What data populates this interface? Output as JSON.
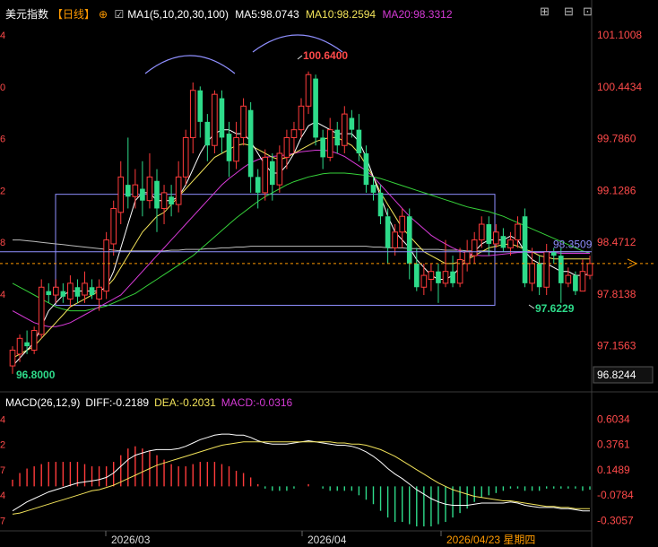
{
  "header": {
    "symbol": "美元指数",
    "period": "【日线】",
    "ma_label": "MA1(5,10,20,30,100)",
    "ma5": "MA5:98.0743",
    "ma10": "MA10:98.2594",
    "ma20": "MA20:98.3312"
  },
  "macd_header": {
    "label": "MACD(26,12,9)",
    "diff": "DIFF:-0.2189",
    "dea": "DEA:-0.2031",
    "macd": "MACD:-0.0316"
  },
  "colors": {
    "up": "#ff3b3b",
    "down": "#2edb8a",
    "ma5": "#ffffff",
    "ma10": "#f2e35a",
    "ma20": "#d63ad6",
    "ma30": "#36d13a",
    "ma100": "#bbbbbb",
    "box": "#8f8fff",
    "last_price": "#ff9a00",
    "cursor_line": "#8f8fff"
  },
  "chart_data": [
    {
      "type": "candlestick",
      "title": "美元指数 【日线】",
      "price_axis": [
        "101.1008",
        "100.4434",
        "99.7860",
        "99.1286",
        "98.4712",
        "97.8138",
        "97.1563"
      ],
      "left_axis_ticks": [
        "4",
        "0",
        "6",
        "2",
        "8",
        "4"
      ],
      "current_label": "96.8244",
      "cursor_label": "98.3509",
      "ylim": [
        96.65,
        101.32
      ],
      "annotations": {
        "high": "100.6400",
        "low_start": "96.8000",
        "low_recent": "97.6229"
      },
      "x_labels": [
        "2026/03",
        "2026/04",
        "2026/04/23 星期四"
      ],
      "candles": [
        [
          96.9,
          97.1,
          96.8,
          97.15
        ],
        [
          97.05,
          97.25,
          96.95,
          97.3
        ],
        [
          97.2,
          97.15,
          97.05,
          97.35
        ],
        [
          97.1,
          97.35,
          97.05,
          97.4
        ],
        [
          97.3,
          97.9,
          97.25,
          98.0
        ],
        [
          97.85,
          97.8,
          97.7,
          97.95
        ],
        [
          97.8,
          97.9,
          97.7,
          98.0
        ],
        [
          97.85,
          97.78,
          97.7,
          97.95
        ],
        [
          97.75,
          97.95,
          97.65,
          98.05
        ],
        [
          97.9,
          97.78,
          97.7,
          98.0
        ],
        [
          97.8,
          97.95,
          97.7,
          98.1
        ],
        [
          97.9,
          97.8,
          97.75,
          98.0
        ],
        [
          97.75,
          97.9,
          97.6,
          98.0
        ],
        [
          97.85,
          98.5,
          97.75,
          98.6
        ],
        [
          98.45,
          98.9,
          98.3,
          99.0
        ],
        [
          98.85,
          99.3,
          98.7,
          99.5
        ],
        [
          99.2,
          99.05,
          98.9,
          99.8
        ],
        [
          99.05,
          99.2,
          98.9,
          99.4
        ],
        [
          99.15,
          99.0,
          98.8,
          99.5
        ],
        [
          99.0,
          99.3,
          98.9,
          99.6
        ],
        [
          99.25,
          98.9,
          98.6,
          99.4
        ],
        [
          98.9,
          99.1,
          98.7,
          99.2
        ],
        [
          99.05,
          98.95,
          98.8,
          99.2
        ],
        [
          98.95,
          99.3,
          98.85,
          99.5
        ],
        [
          99.3,
          99.8,
          99.2,
          99.9
        ],
        [
          99.8,
          100.4,
          99.6,
          100.5
        ],
        [
          100.4,
          100.0,
          99.8,
          100.45
        ],
        [
          100.0,
          99.7,
          99.5,
          100.1
        ],
        [
          99.7,
          100.35,
          99.6,
          100.4
        ],
        [
          100.3,
          99.8,
          99.6,
          100.4
        ],
        [
          99.85,
          99.5,
          99.3,
          100.0
        ],
        [
          99.5,
          99.8,
          99.4,
          100.0
        ],
        [
          99.8,
          100.2,
          99.7,
          100.3
        ],
        [
          100.15,
          99.3,
          99.1,
          100.25
        ],
        [
          99.3,
          99.1,
          98.9,
          99.4
        ],
        [
          99.1,
          99.55,
          99.0,
          99.65
        ],
        [
          99.5,
          99.2,
          99.0,
          99.6
        ],
        [
          99.2,
          99.6,
          99.1,
          99.7
        ],
        [
          99.55,
          99.8,
          99.4,
          99.9
        ],
        [
          99.8,
          99.9,
          99.6,
          100.0
        ],
        [
          99.9,
          100.2,
          99.8,
          100.3
        ],
        [
          100.2,
          100.6,
          100.1,
          100.64
        ],
        [
          100.55,
          99.8,
          99.7,
          100.6
        ],
        [
          99.8,
          99.55,
          99.4,
          99.9
        ],
        [
          99.55,
          99.9,
          99.5,
          100.05
        ],
        [
          99.9,
          99.7,
          99.6,
          100.0
        ],
        [
          99.7,
          100.1,
          99.6,
          100.2
        ],
        [
          100.05,
          99.9,
          99.8,
          100.15
        ],
        [
          99.9,
          99.6,
          99.5,
          100.1
        ],
        [
          99.6,
          99.2,
          99.1,
          99.7
        ],
        [
          99.2,
          99.1,
          99.0,
          99.3
        ],
        [
          99.1,
          98.8,
          98.7,
          99.2
        ],
        [
          98.8,
          98.4,
          98.2,
          98.9
        ],
        [
          98.4,
          98.6,
          98.3,
          98.7
        ],
        [
          98.6,
          98.8,
          98.4,
          98.9
        ],
        [
          98.8,
          98.2,
          98.0,
          98.9
        ],
        [
          98.2,
          97.9,
          97.85,
          98.4
        ],
        [
          97.9,
          98.05,
          97.8,
          98.2
        ],
        [
          98.0,
          98.1,
          97.85,
          98.2
        ],
        [
          98.1,
          97.95,
          97.7,
          98.2
        ],
        [
          97.95,
          98.1,
          97.9,
          98.5
        ],
        [
          98.1,
          97.95,
          97.9,
          98.3
        ],
        [
          97.95,
          98.25,
          97.9,
          98.4
        ],
        [
          98.2,
          98.35,
          98.1,
          98.5
        ],
        [
          98.3,
          98.5,
          98.2,
          98.6
        ],
        [
          98.5,
          98.7,
          98.4,
          98.8
        ],
        [
          98.7,
          98.45,
          98.3,
          98.8
        ],
        [
          98.45,
          98.6,
          98.4,
          98.7
        ],
        [
          98.55,
          98.4,
          98.35,
          98.65
        ],
        [
          98.4,
          98.5,
          98.3,
          98.6
        ],
        [
          98.5,
          98.7,
          98.4,
          98.8
        ],
        [
          98.8,
          97.95,
          97.9,
          98.9
        ],
        [
          97.95,
          98.2,
          97.85,
          98.4
        ],
        [
          98.2,
          97.9,
          97.8,
          98.3
        ],
        [
          97.9,
          98.35,
          97.8,
          98.45
        ],
        [
          98.35,
          98.3,
          98.2,
          98.4
        ],
        [
          98.3,
          97.95,
          97.7,
          98.4
        ],
        [
          97.95,
          98.05,
          97.9,
          98.15
        ],
        [
          98.05,
          97.85,
          97.8,
          98.1
        ],
        [
          97.85,
          98.1,
          97.85,
          98.25
        ],
        [
          98.05,
          98.2,
          98.0,
          98.3
        ]
      ],
      "ma5": [
        96.9,
        97.0,
        97.1,
        97.2,
        97.4,
        97.6,
        97.7,
        97.8,
        97.85,
        97.85,
        97.85,
        97.85,
        97.85,
        97.9,
        98.1,
        98.4,
        98.7,
        99.0,
        99.1,
        99.1,
        99.0,
        99.0,
        99.0,
        99.05,
        99.2,
        99.4,
        99.6,
        99.75,
        99.85,
        99.9,
        99.9,
        99.85,
        99.85,
        99.75,
        99.6,
        99.45,
        99.35,
        99.35,
        99.45,
        99.6,
        99.8,
        99.95,
        100.0,
        99.95,
        99.9,
        99.85,
        99.85,
        99.85,
        99.75,
        99.55,
        99.3,
        99.05,
        98.8,
        98.6,
        98.5,
        98.4,
        98.25,
        98.15,
        98.05,
        98.0,
        98.0,
        98.05,
        98.15,
        98.25,
        98.35,
        98.45,
        98.5,
        98.5,
        98.5,
        98.55,
        98.5,
        98.35,
        98.25,
        98.2,
        98.2,
        98.15,
        98.1,
        98.1,
        98.05,
        98.05,
        98.07
      ],
      "ma10": [
        97.0,
        97.05,
        97.1,
        97.15,
        97.25,
        97.35,
        97.45,
        97.55,
        97.65,
        97.7,
        97.75,
        97.8,
        97.85,
        97.9,
        98.0,
        98.15,
        98.3,
        98.45,
        98.6,
        98.7,
        98.8,
        98.85,
        98.95,
        99.05,
        99.15,
        99.25,
        99.35,
        99.45,
        99.55,
        99.6,
        99.65,
        99.7,
        99.72,
        99.7,
        99.65,
        99.6,
        99.55,
        99.52,
        99.55,
        99.6,
        99.65,
        99.7,
        99.75,
        99.78,
        99.8,
        99.8,
        99.75,
        99.7,
        99.6,
        99.45,
        99.3,
        99.1,
        98.95,
        98.8,
        98.65,
        98.55,
        98.45,
        98.35,
        98.3,
        98.25,
        98.2,
        98.2,
        98.22,
        98.25,
        98.3,
        98.35,
        98.4,
        98.42,
        98.44,
        98.45,
        98.42,
        98.38,
        98.35,
        98.3,
        98.28,
        98.26,
        98.26,
        98.26,
        98.26,
        98.26,
        98.26
      ],
      "ma20": [
        97.6,
        97.55,
        97.5,
        97.45,
        97.42,
        97.4,
        97.4,
        97.42,
        97.45,
        97.5,
        97.55,
        97.6,
        97.65,
        97.7,
        97.75,
        97.8,
        97.9,
        98.0,
        98.1,
        98.2,
        98.3,
        98.4,
        98.5,
        98.6,
        98.7,
        98.8,
        98.9,
        99.0,
        99.1,
        99.2,
        99.28,
        99.35,
        99.42,
        99.48,
        99.52,
        99.55,
        99.56,
        99.57,
        99.58,
        99.6,
        99.62,
        99.63,
        99.64,
        99.64,
        99.63,
        99.6,
        99.56,
        99.5,
        99.44,
        99.38,
        99.3,
        99.2,
        99.1,
        99.0,
        98.9,
        98.8,
        98.72,
        98.64,
        98.56,
        98.5,
        98.45,
        98.4,
        98.36,
        98.33,
        98.31,
        98.3,
        98.3,
        98.31,
        98.32,
        98.33,
        98.34,
        98.34,
        98.34,
        98.34,
        98.34,
        98.34,
        98.33,
        98.33,
        98.33,
        98.33,
        98.33
      ],
      "ma30": [
        97.95,
        97.9,
        97.85,
        97.8,
        97.75,
        97.7,
        97.65,
        97.62,
        97.6,
        97.6,
        97.6,
        97.62,
        97.64,
        97.66,
        97.7,
        97.74,
        97.78,
        97.82,
        97.88,
        97.94,
        98.0,
        98.06,
        98.12,
        98.18,
        98.24,
        98.3,
        98.38,
        98.46,
        98.54,
        98.62,
        98.7,
        98.78,
        98.85,
        98.92,
        98.99,
        99.05,
        99.1,
        99.15,
        99.2,
        99.24,
        99.27,
        99.3,
        99.32,
        99.34,
        99.35,
        99.35,
        99.35,
        99.34,
        99.33,
        99.32,
        99.3,
        99.28,
        99.25,
        99.22,
        99.19,
        99.16,
        99.13,
        99.1,
        99.07,
        99.04,
        99.01,
        98.98,
        98.95,
        98.92,
        98.9,
        98.88,
        98.86,
        98.83,
        98.8,
        98.76,
        98.72,
        98.68,
        98.64,
        98.6,
        98.56,
        98.52,
        98.48,
        98.44,
        98.4,
        98.36,
        98.33
      ],
      "ma100": [
        98.5,
        98.5,
        98.49,
        98.48,
        98.47,
        98.46,
        98.45,
        98.44,
        98.43,
        98.42,
        98.41,
        98.4,
        98.39,
        98.38,
        98.37,
        98.36,
        98.36,
        98.36,
        98.36,
        98.36,
        98.36,
        98.36,
        98.37,
        98.37,
        98.38,
        98.38,
        98.38,
        98.39,
        98.39,
        98.4,
        98.4,
        98.41,
        98.41,
        98.42,
        98.42,
        98.42,
        98.42,
        98.42,
        98.42,
        98.42,
        98.42,
        98.42,
        98.42,
        98.42,
        98.42,
        98.42,
        98.42,
        98.42,
        98.42,
        98.42,
        98.41,
        98.41,
        98.4,
        98.4,
        98.4,
        98.39,
        98.39,
        98.38,
        98.38,
        98.38,
        98.37,
        98.37,
        98.37,
        98.36,
        98.36,
        98.36,
        98.36,
        98.35,
        98.35,
        98.35,
        98.35,
        98.35,
        98.35,
        98.35,
        98.35,
        98.35,
        98.35,
        98.35,
        98.35,
        98.35,
        98.35
      ]
    },
    {
      "type": "macd",
      "title": "MACD(26,12,9)",
      "y_axis": [
        "0.6034",
        "0.3761",
        "0.1489",
        "-0.0784",
        "-0.3057"
      ],
      "left_axis_ticks": [
        "4",
        "2",
        "7",
        "4",
        "7"
      ],
      "ylim": [
        -0.4,
        0.68
      ],
      "diff": [
        -0.22,
        -0.18,
        -0.14,
        -0.11,
        -0.08,
        -0.05,
        -0.03,
        -0.01,
        0.01,
        0.03,
        0.04,
        0.05,
        0.06,
        0.08,
        0.12,
        0.18,
        0.24,
        0.28,
        0.3,
        0.32,
        0.33,
        0.33,
        0.33,
        0.34,
        0.36,
        0.39,
        0.42,
        0.44,
        0.46,
        0.47,
        0.47,
        0.46,
        0.46,
        0.44,
        0.41,
        0.39,
        0.38,
        0.38,
        0.38,
        0.39,
        0.4,
        0.41,
        0.4,
        0.39,
        0.38,
        0.37,
        0.37,
        0.36,
        0.34,
        0.31,
        0.27,
        0.22,
        0.16,
        0.11,
        0.07,
        0.02,
        -0.03,
        -0.07,
        -0.11,
        -0.14,
        -0.16,
        -0.17,
        -0.17,
        -0.17,
        -0.16,
        -0.15,
        -0.15,
        -0.15,
        -0.15,
        -0.14,
        -0.15,
        -0.17,
        -0.18,
        -0.19,
        -0.19,
        -0.19,
        -0.2,
        -0.2,
        -0.21,
        -0.22,
        -0.22
      ],
      "dea": [
        -0.25,
        -0.24,
        -0.22,
        -0.2,
        -0.18,
        -0.16,
        -0.14,
        -0.12,
        -0.1,
        -0.08,
        -0.06,
        -0.04,
        -0.03,
        -0.01,
        0.01,
        0.04,
        0.07,
        0.1,
        0.13,
        0.16,
        0.19,
        0.21,
        0.23,
        0.25,
        0.27,
        0.29,
        0.31,
        0.33,
        0.35,
        0.37,
        0.38,
        0.39,
        0.4,
        0.4,
        0.4,
        0.4,
        0.4,
        0.4,
        0.4,
        0.4,
        0.4,
        0.4,
        0.4,
        0.4,
        0.4,
        0.39,
        0.39,
        0.38,
        0.38,
        0.37,
        0.35,
        0.33,
        0.3,
        0.27,
        0.23,
        0.19,
        0.15,
        0.11,
        0.07,
        0.03,
        0.0,
        -0.03,
        -0.05,
        -0.07,
        -0.09,
        -0.1,
        -0.11,
        -0.12,
        -0.13,
        -0.13,
        -0.14,
        -0.15,
        -0.16,
        -0.17,
        -0.18,
        -0.18,
        -0.19,
        -0.19,
        -0.2,
        -0.2,
        -0.2
      ],
      "macd": [
        0.06,
        0.12,
        0.16,
        0.18,
        0.2,
        0.22,
        0.22,
        0.22,
        0.22,
        0.22,
        0.2,
        0.18,
        0.18,
        0.18,
        0.22,
        0.28,
        0.34,
        0.36,
        0.34,
        0.32,
        0.28,
        0.24,
        0.2,
        0.18,
        0.18,
        0.2,
        0.22,
        0.22,
        0.22,
        0.2,
        0.18,
        0.14,
        0.12,
        0.08,
        0.02,
        -0.02,
        -0.04,
        -0.04,
        -0.04,
        -0.02,
        0.0,
        0.02,
        0.0,
        -0.02,
        -0.04,
        -0.04,
        -0.04,
        -0.04,
        -0.08,
        -0.12,
        -0.16,
        -0.22,
        -0.28,
        -0.32,
        -0.32,
        -0.34,
        -0.36,
        -0.36,
        -0.36,
        -0.34,
        -0.32,
        -0.28,
        -0.24,
        -0.2,
        -0.14,
        -0.1,
        -0.08,
        -0.06,
        -0.04,
        -0.02,
        -0.02,
        -0.04,
        -0.04,
        -0.04,
        -0.02,
        -0.02,
        -0.02,
        -0.02,
        -0.02,
        -0.04,
        -0.03
      ]
    }
  ]
}
